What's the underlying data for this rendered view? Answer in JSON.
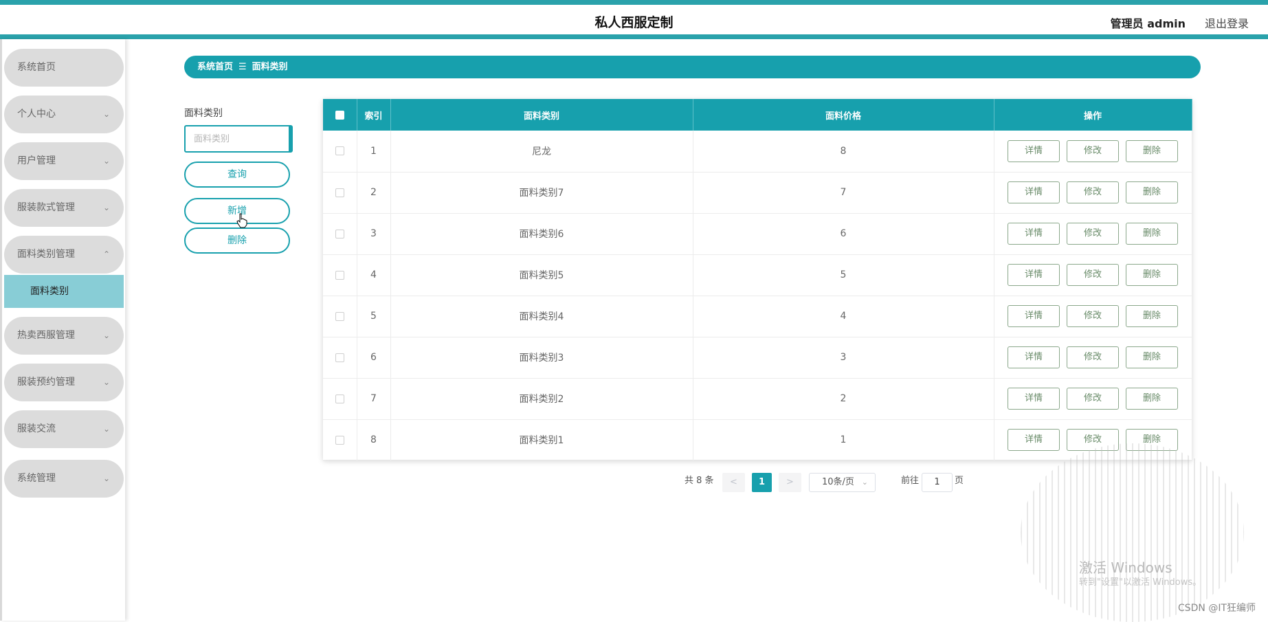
{
  "header": {
    "title": "私人西服定制",
    "user": "管理员 admin",
    "logout": "退出登录"
  },
  "sidebar": {
    "items": [
      {
        "label": "系统首页",
        "chevron": ""
      },
      {
        "label": "个人中心",
        "chevron": "⌄"
      },
      {
        "label": "用户管理",
        "chevron": "⌄"
      },
      {
        "label": "服装款式管理",
        "chevron": "⌄"
      },
      {
        "label": "面料类别管理",
        "chevron": "⌃"
      },
      {
        "label": "热卖西服管理",
        "chevron": "⌄"
      },
      {
        "label": "服装预约管理",
        "chevron": "⌄"
      },
      {
        "label": "服装交流",
        "chevron": "⌄"
      },
      {
        "label": "系统管理",
        "chevron": "⌄"
      }
    ],
    "submenu": {
      "label": "面料类别"
    }
  },
  "breadcrumb": {
    "home": "系统首页",
    "separator": "☰",
    "current": "面料类别"
  },
  "search": {
    "label": "面料类别",
    "placeholder": "面料类别",
    "query_button": "查询",
    "add_button": "新增",
    "delete_button": "删除"
  },
  "table": {
    "headers": {
      "index": "索引",
      "category": "面料类别",
      "price": "面料价格",
      "ops": "操作"
    },
    "ops": {
      "detail": "详情",
      "edit": "修改",
      "delete": "删除"
    },
    "rows": [
      {
        "index": "1",
        "category": "尼龙",
        "price": "8"
      },
      {
        "index": "2",
        "category": "面料类别7",
        "price": "7"
      },
      {
        "index": "3",
        "category": "面料类别6",
        "price": "6"
      },
      {
        "index": "4",
        "category": "面料类别5",
        "price": "5"
      },
      {
        "index": "5",
        "category": "面料类别4",
        "price": "4"
      },
      {
        "index": "6",
        "category": "面料类别3",
        "price": "3"
      },
      {
        "index": "7",
        "category": "面料类别2",
        "price": "2"
      },
      {
        "index": "8",
        "category": "面料类别1",
        "price": "1"
      }
    ]
  },
  "pagination": {
    "total": "共 8 条",
    "prev": "<",
    "current": "1",
    "next": ">",
    "page_size": "10条/页",
    "goto_label": "前往",
    "goto_value": "1",
    "page_unit": "页"
  },
  "watermark": {
    "activate_title": "激活 Windows",
    "activate_sub": "转到\"设置\"以激活 Windows。",
    "csdn": "CSDN @IT狂编师"
  },
  "colors": {
    "accent": "#17a0ad",
    "top_border": "#2aa2ab",
    "submenu_active": "#88cdd6",
    "op_button": "#8aa78a"
  }
}
